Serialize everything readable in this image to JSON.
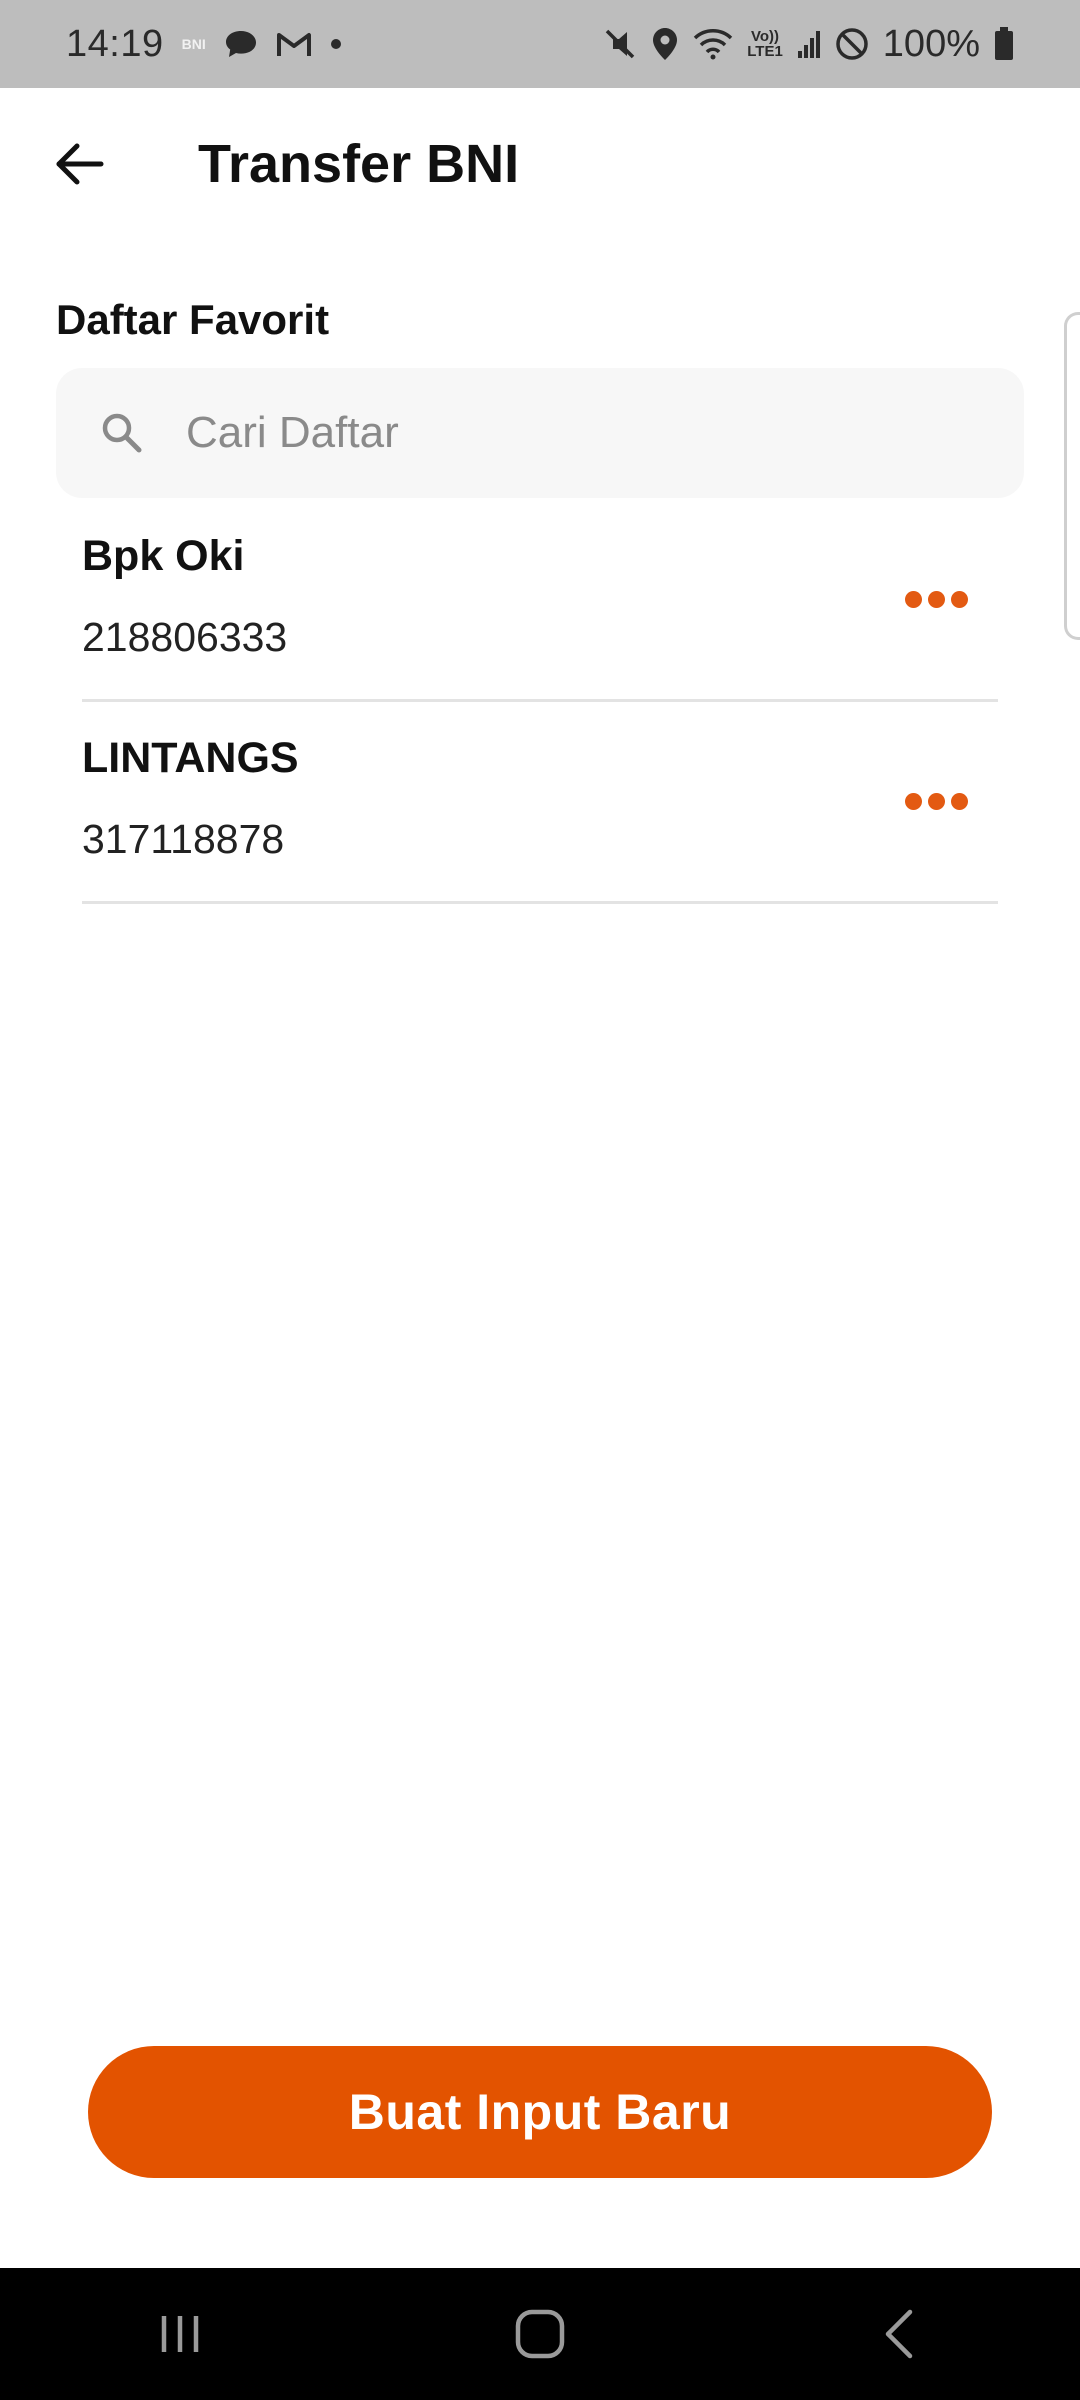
{
  "status_bar": {
    "time": "14:19",
    "bni_mini": "BNI",
    "battery_text": "100%",
    "lte_top": "Vo))",
    "lte_bottom": "LTE1"
  },
  "header": {
    "title": "Transfer BNI",
    "back_icon": "arrow-left-icon"
  },
  "favorites": {
    "section_title": "Daftar Favorit",
    "search_placeholder": "Cari Daftar",
    "search_value": "",
    "items": [
      {
        "name": "Bpk Oki",
        "account_number": "218806333"
      },
      {
        "name": "LINTANGS",
        "account_number": "317118878"
      }
    ]
  },
  "actions": {
    "new_input_label": "Buat Input Baru"
  },
  "colors": {
    "accent": "#E35300",
    "dots": "#E35A12",
    "status_bar_bg": "#BDBDBD",
    "nav_bar_bg": "#000000",
    "search_bg": "#F7F7F7"
  },
  "system_nav": {
    "recents_icon": "recent-apps-icon",
    "home_icon": "home-icon",
    "back_icon": "back-chevron-icon"
  }
}
